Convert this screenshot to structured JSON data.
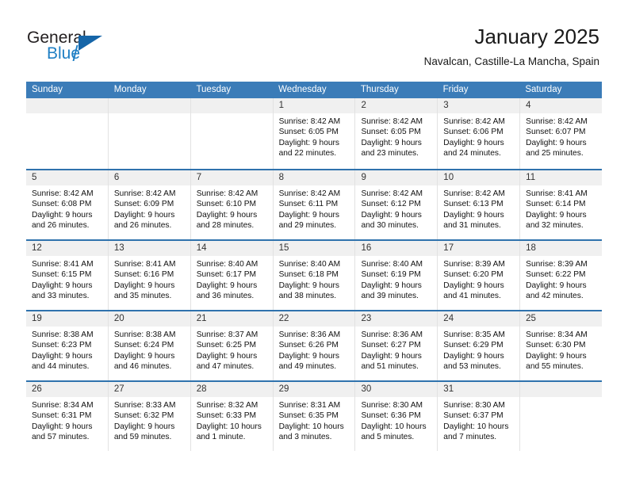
{
  "brand": {
    "name_part1": "General",
    "name_part2": "Blue",
    "triangle_color": "#1565a8",
    "blue_color": "#1f7fc4"
  },
  "header": {
    "title": "January 2025",
    "subtitle": "Navalcan, Castille-La Mancha, Spain"
  },
  "theme": {
    "header_bg": "#3b7cb8",
    "week_divider": "#2f72ad",
    "day_band_bg": "#f0f0f0",
    "cell_border": "#e2e2e2"
  },
  "weekdays": [
    "Sunday",
    "Monday",
    "Tuesday",
    "Wednesday",
    "Thursday",
    "Friday",
    "Saturday"
  ],
  "weeks": [
    [
      {
        "day": "",
        "info": ""
      },
      {
        "day": "",
        "info": ""
      },
      {
        "day": "",
        "info": ""
      },
      {
        "day": "1",
        "info": "Sunrise: 8:42 AM\nSunset: 6:05 PM\nDaylight: 9 hours\nand 22 minutes."
      },
      {
        "day": "2",
        "info": "Sunrise: 8:42 AM\nSunset: 6:05 PM\nDaylight: 9 hours\nand 23 minutes."
      },
      {
        "day": "3",
        "info": "Sunrise: 8:42 AM\nSunset: 6:06 PM\nDaylight: 9 hours\nand 24 minutes."
      },
      {
        "day": "4",
        "info": "Sunrise: 8:42 AM\nSunset: 6:07 PM\nDaylight: 9 hours\nand 25 minutes."
      }
    ],
    [
      {
        "day": "5",
        "info": "Sunrise: 8:42 AM\nSunset: 6:08 PM\nDaylight: 9 hours\nand 26 minutes."
      },
      {
        "day": "6",
        "info": "Sunrise: 8:42 AM\nSunset: 6:09 PM\nDaylight: 9 hours\nand 26 minutes."
      },
      {
        "day": "7",
        "info": "Sunrise: 8:42 AM\nSunset: 6:10 PM\nDaylight: 9 hours\nand 28 minutes."
      },
      {
        "day": "8",
        "info": "Sunrise: 8:42 AM\nSunset: 6:11 PM\nDaylight: 9 hours\nand 29 minutes."
      },
      {
        "day": "9",
        "info": "Sunrise: 8:42 AM\nSunset: 6:12 PM\nDaylight: 9 hours\nand 30 minutes."
      },
      {
        "day": "10",
        "info": "Sunrise: 8:42 AM\nSunset: 6:13 PM\nDaylight: 9 hours\nand 31 minutes."
      },
      {
        "day": "11",
        "info": "Sunrise: 8:41 AM\nSunset: 6:14 PM\nDaylight: 9 hours\nand 32 minutes."
      }
    ],
    [
      {
        "day": "12",
        "info": "Sunrise: 8:41 AM\nSunset: 6:15 PM\nDaylight: 9 hours\nand 33 minutes."
      },
      {
        "day": "13",
        "info": "Sunrise: 8:41 AM\nSunset: 6:16 PM\nDaylight: 9 hours\nand 35 minutes."
      },
      {
        "day": "14",
        "info": "Sunrise: 8:40 AM\nSunset: 6:17 PM\nDaylight: 9 hours\nand 36 minutes."
      },
      {
        "day": "15",
        "info": "Sunrise: 8:40 AM\nSunset: 6:18 PM\nDaylight: 9 hours\nand 38 minutes."
      },
      {
        "day": "16",
        "info": "Sunrise: 8:40 AM\nSunset: 6:19 PM\nDaylight: 9 hours\nand 39 minutes."
      },
      {
        "day": "17",
        "info": "Sunrise: 8:39 AM\nSunset: 6:20 PM\nDaylight: 9 hours\nand 41 minutes."
      },
      {
        "day": "18",
        "info": "Sunrise: 8:39 AM\nSunset: 6:22 PM\nDaylight: 9 hours\nand 42 minutes."
      }
    ],
    [
      {
        "day": "19",
        "info": "Sunrise: 8:38 AM\nSunset: 6:23 PM\nDaylight: 9 hours\nand 44 minutes."
      },
      {
        "day": "20",
        "info": "Sunrise: 8:38 AM\nSunset: 6:24 PM\nDaylight: 9 hours\nand 46 minutes."
      },
      {
        "day": "21",
        "info": "Sunrise: 8:37 AM\nSunset: 6:25 PM\nDaylight: 9 hours\nand 47 minutes."
      },
      {
        "day": "22",
        "info": "Sunrise: 8:36 AM\nSunset: 6:26 PM\nDaylight: 9 hours\nand 49 minutes."
      },
      {
        "day": "23",
        "info": "Sunrise: 8:36 AM\nSunset: 6:27 PM\nDaylight: 9 hours\nand 51 minutes."
      },
      {
        "day": "24",
        "info": "Sunrise: 8:35 AM\nSunset: 6:29 PM\nDaylight: 9 hours\nand 53 minutes."
      },
      {
        "day": "25",
        "info": "Sunrise: 8:34 AM\nSunset: 6:30 PM\nDaylight: 9 hours\nand 55 minutes."
      }
    ],
    [
      {
        "day": "26",
        "info": "Sunrise: 8:34 AM\nSunset: 6:31 PM\nDaylight: 9 hours\nand 57 minutes."
      },
      {
        "day": "27",
        "info": "Sunrise: 8:33 AM\nSunset: 6:32 PM\nDaylight: 9 hours\nand 59 minutes."
      },
      {
        "day": "28",
        "info": "Sunrise: 8:32 AM\nSunset: 6:33 PM\nDaylight: 10 hours\nand 1 minute."
      },
      {
        "day": "29",
        "info": "Sunrise: 8:31 AM\nSunset: 6:35 PM\nDaylight: 10 hours\nand 3 minutes."
      },
      {
        "day": "30",
        "info": "Sunrise: 8:30 AM\nSunset: 6:36 PM\nDaylight: 10 hours\nand 5 minutes."
      },
      {
        "day": "31",
        "info": "Sunrise: 8:30 AM\nSunset: 6:37 PM\nDaylight: 10 hours\nand 7 minutes."
      },
      {
        "day": "",
        "info": ""
      }
    ]
  ]
}
